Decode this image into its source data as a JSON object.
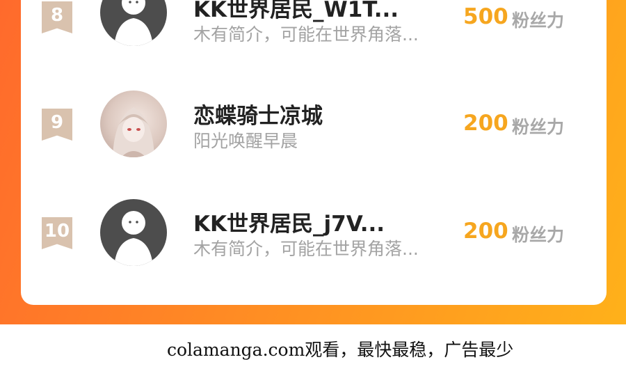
{
  "unit_label": "粉丝力",
  "rows": [
    {
      "rank": "8",
      "name": "KK世界居民_W1T...",
      "bio": "木有简介，可能在世界角落...",
      "score": "500",
      "avatar": "default-avatar"
    },
    {
      "rank": "9",
      "name": "恋蝶骑士凉城",
      "bio": "阳光唤醒早晨",
      "score": "200",
      "avatar": "anime-avatar"
    },
    {
      "rank": "10",
      "name": "KK世界居民_j7V...",
      "bio": "木有简介，可能在世界角落...",
      "score": "200",
      "avatar": "default-avatar"
    }
  ],
  "footer": {
    "watermark": "colamanga.com观看，最快最稳，广告最少"
  },
  "colors": {
    "banner_start": "#ff6a2c",
    "banner_end": "#ffb11a",
    "score": "#f6a61f",
    "rank_badge": "#d9c2ae"
  }
}
